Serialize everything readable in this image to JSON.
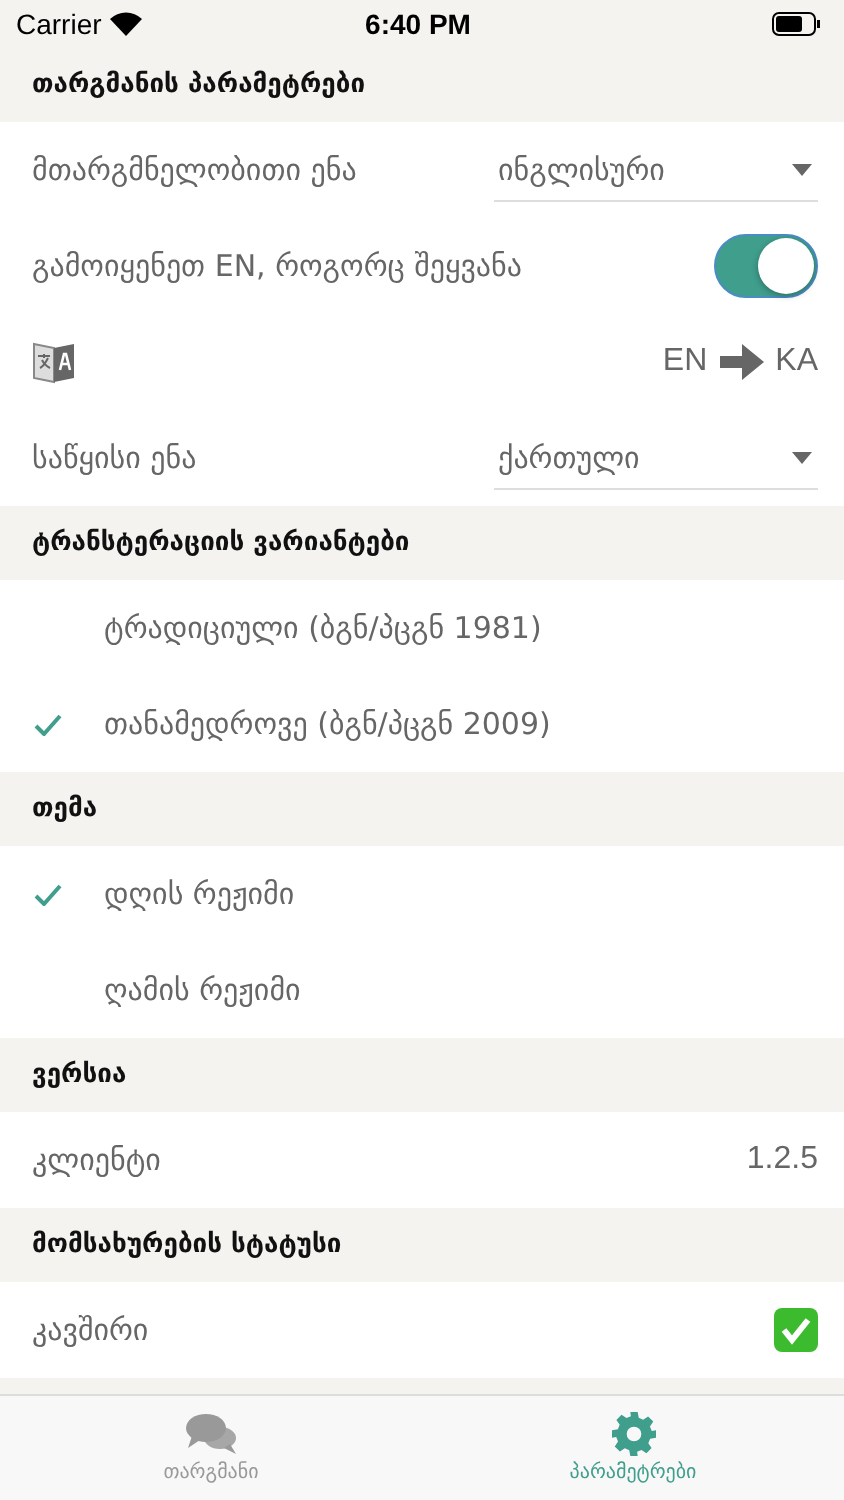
{
  "status_bar": {
    "carrier": "Carrier",
    "time": "6:40 PM"
  },
  "sections": [
    {
      "title": "თარგმანის პარამეტრები",
      "rows": [
        {
          "kind": "dropdown",
          "label": "მთარგმნელობითი ენა",
          "value": "ინგლისური"
        },
        {
          "kind": "toggle",
          "label": "გამოიყენეთ EN, როგორც შეყვანა",
          "on": true
        },
        {
          "kind": "direction",
          "from": "EN",
          "to": "KA"
        },
        {
          "kind": "dropdown",
          "label": "საწყისი ენა",
          "value": "ქართული"
        }
      ]
    },
    {
      "title": "ტრანსტერაციის ვარიანტები",
      "rows": [
        {
          "kind": "choice",
          "label": "ტრადიციული (ბგნ/პცგნ 1981)",
          "selected": false
        },
        {
          "kind": "choice",
          "label": "თანამედროვე (ბგნ/პცგნ 2009)",
          "selected": true
        }
      ]
    },
    {
      "title": "თემა",
      "rows": [
        {
          "kind": "choice",
          "label": "დღის რეჟიმი",
          "selected": true
        },
        {
          "kind": "choice",
          "label": "ღამის რეჟიმი",
          "selected": false
        }
      ]
    },
    {
      "title": "ვერსია",
      "rows": [
        {
          "kind": "value",
          "label": "კლიენტი",
          "value": "1.2.5"
        }
      ]
    },
    {
      "title": "მომსახურების სტატუსი",
      "rows": [
        {
          "kind": "status",
          "label": "კავშირი",
          "connected": true
        }
      ]
    }
  ],
  "tabs": [
    {
      "label": "თარგმანი",
      "selected": false
    },
    {
      "label": "პარამეტრები",
      "selected": true
    }
  ]
}
